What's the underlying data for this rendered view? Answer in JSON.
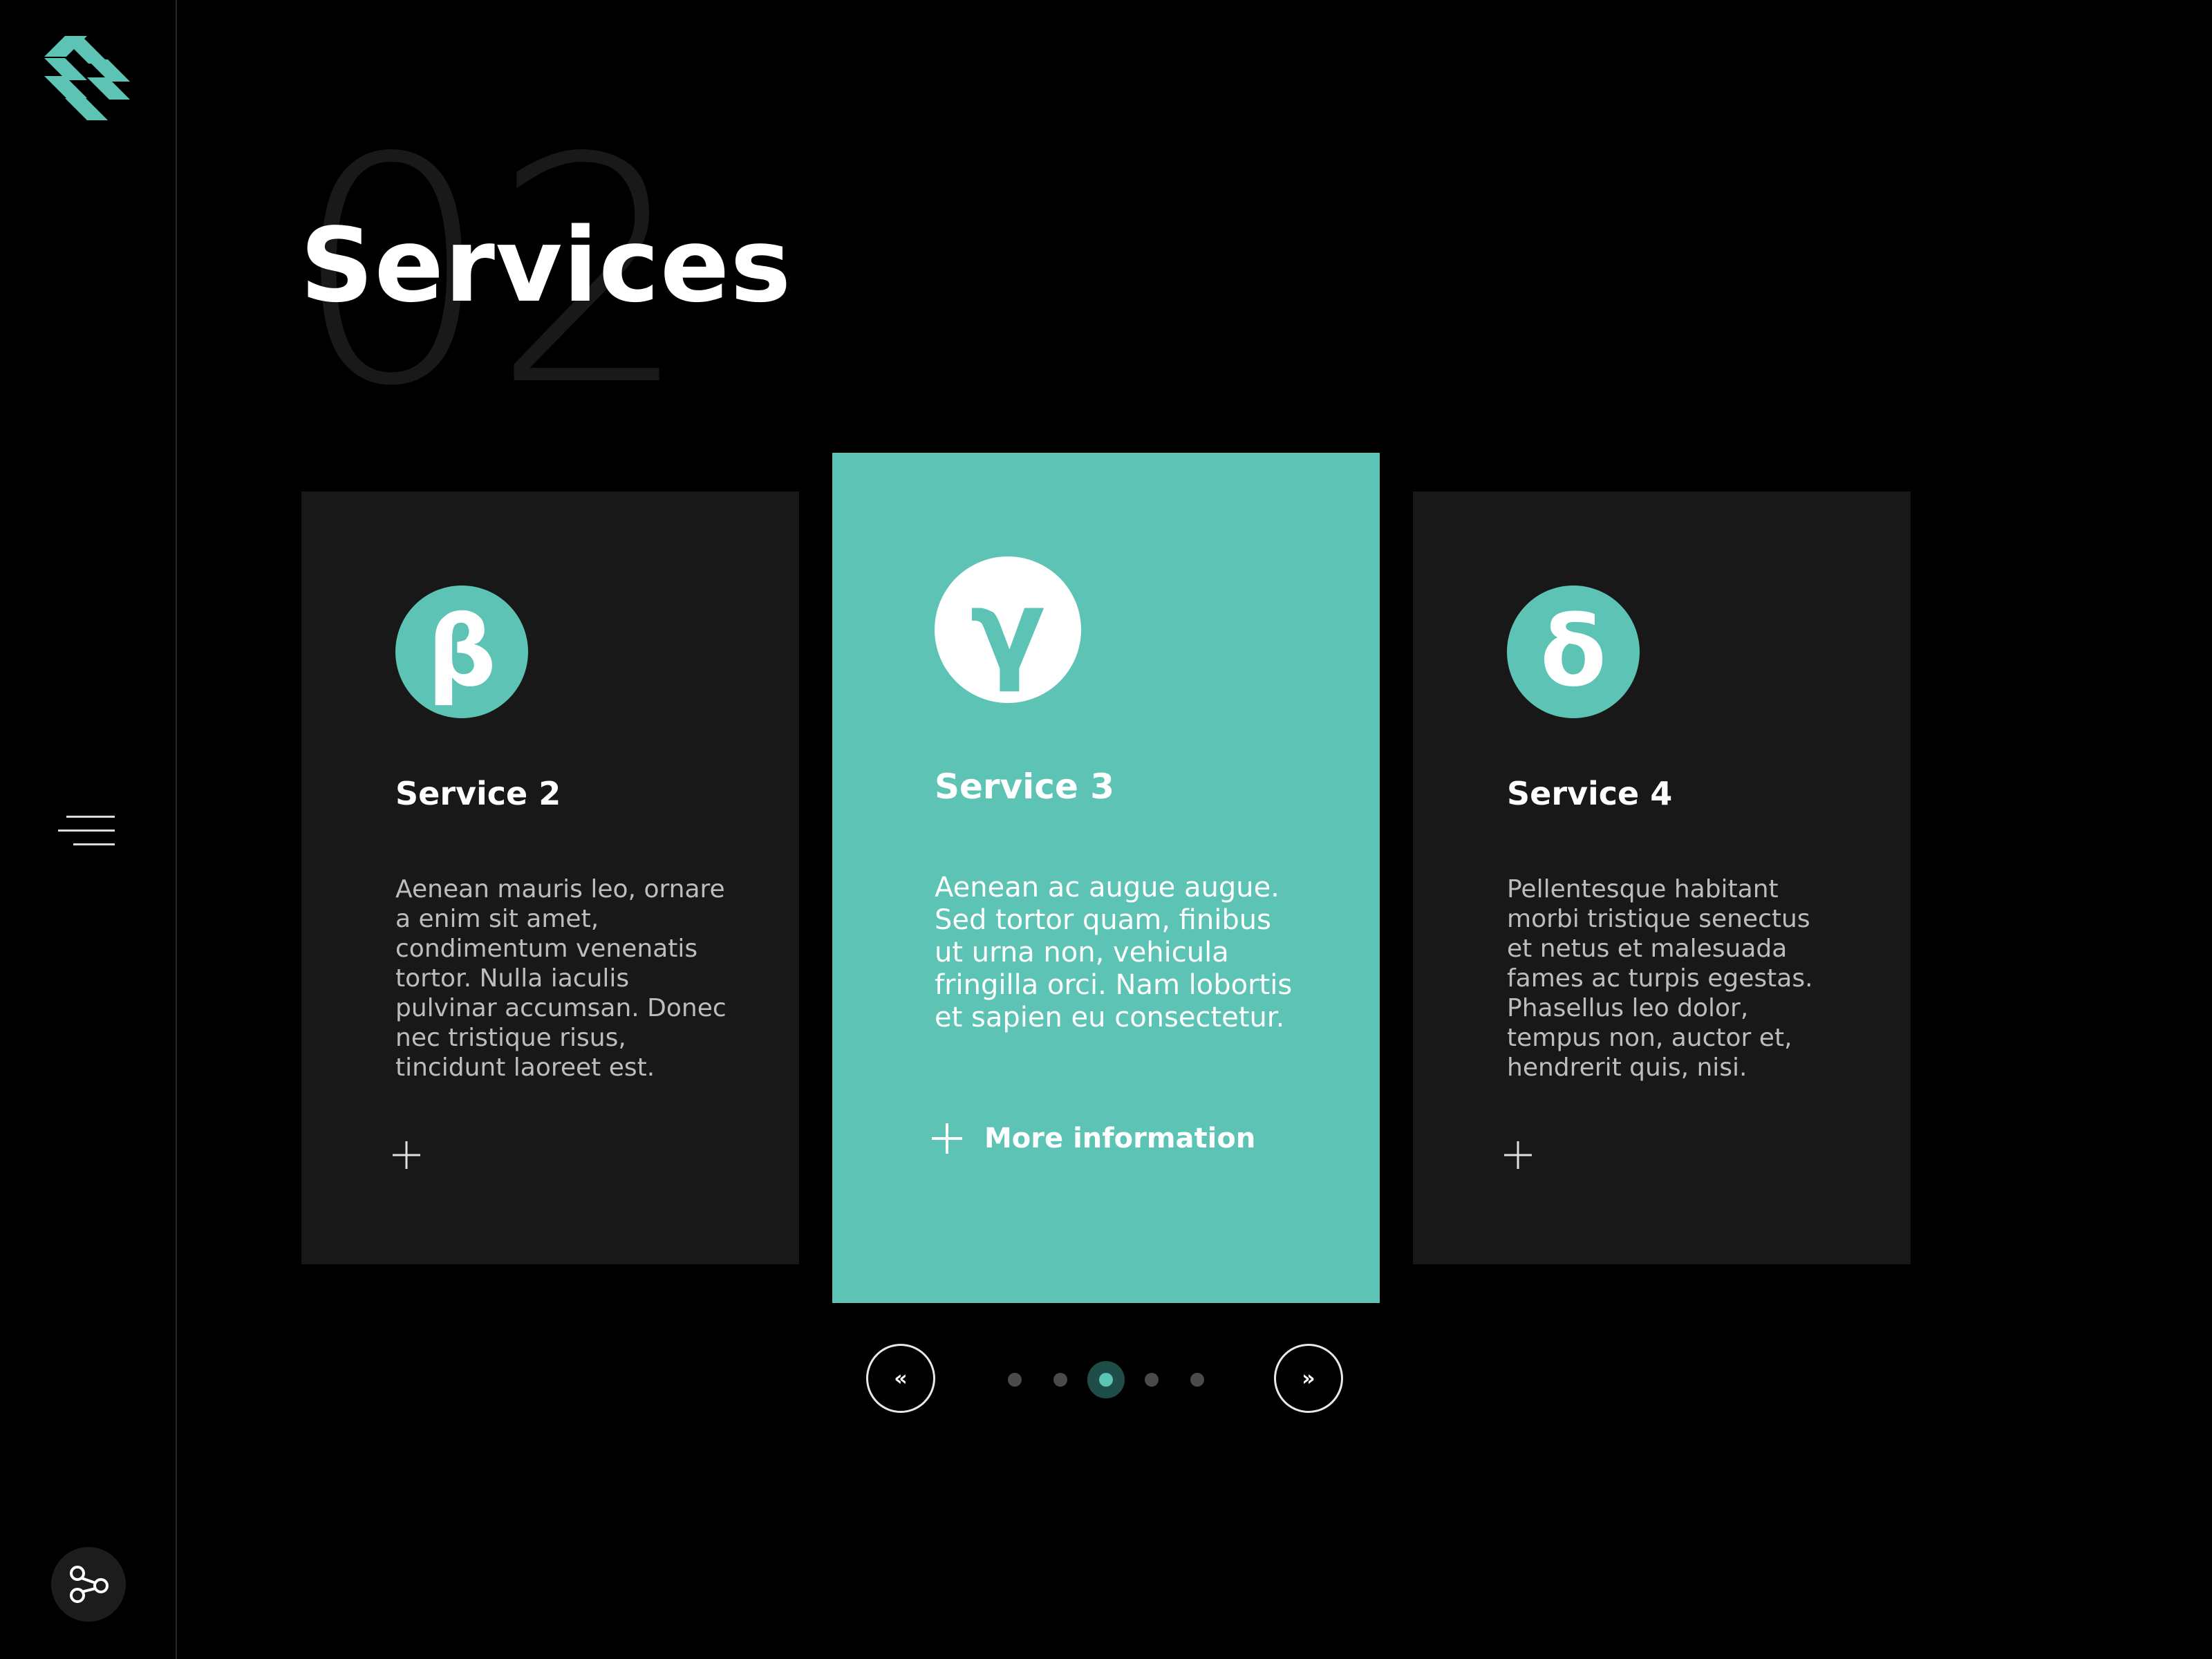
{
  "section": {
    "number": "02",
    "title": "Services"
  },
  "sidebar": {
    "logo": "stripes-logo-icon",
    "menu_icon": "hamburger-menu-icon",
    "share_icon": "share-nodes-icon"
  },
  "cards": [
    {
      "icon_glyph": "β",
      "title": "Service 2",
      "text": "Aenean mauris leo, ornare a enim sit amet, condimentum venenatis tortor. Nulla iaculis pulvinar accumsan. Donec nec tristique risus, tincidunt laoreet est."
    },
    {
      "icon_glyph": "γ",
      "title": "Service 3",
      "text": "Aenean ac augue augue. Sed tortor quam, finibus ut urna non, vehicula fringilla orci. Nam lobortis et sapien eu consectetur.",
      "more_label": "More information"
    },
    {
      "icon_glyph": "δ",
      "title": "Service 4",
      "text": "Pellentesque habitant morbi tristique senectus et netus et malesuada fames ac turpis egestas. Phasellus leo dolor, tempus non, auctor et, hendrerit quis, nisi."
    }
  ],
  "slider": {
    "prev_label": "«",
    "next_label": "»",
    "dot_count": 5,
    "active_index": 2
  },
  "colors": {
    "accent": "#5cc3b5",
    "background": "#000000",
    "card_bg": "#181818"
  }
}
